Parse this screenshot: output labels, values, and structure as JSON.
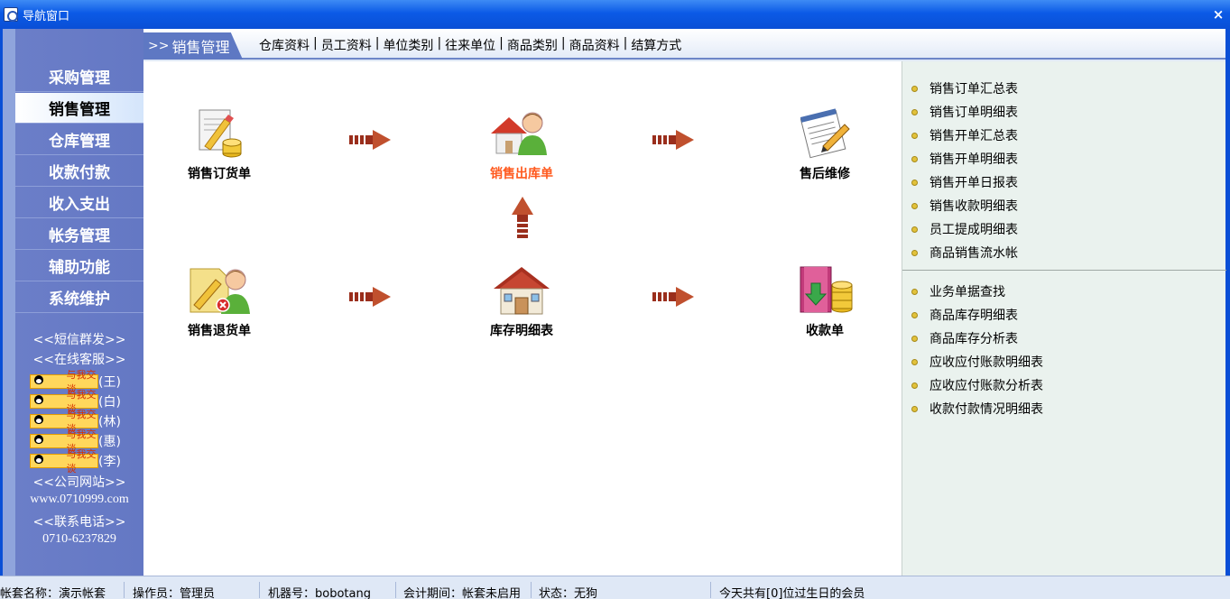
{
  "window": {
    "title": "导航窗口",
    "close_label": "×"
  },
  "sidebar": {
    "items": [
      {
        "label": "采购管理"
      },
      {
        "label": "销售管理"
      },
      {
        "label": "仓库管理"
      },
      {
        "label": "收款付款"
      },
      {
        "label": "收入支出"
      },
      {
        "label": "帐务管理"
      },
      {
        "label": "辅助功能"
      },
      {
        "label": "系统维护"
      }
    ],
    "active_index": 1,
    "sms": "<<短信群发>>",
    "online_service": "<<在线客服>>",
    "qq_badge": "与我交谈",
    "agents": [
      {
        "name": "(王)"
      },
      {
        "name": "(白)"
      },
      {
        "name": "(林)"
      },
      {
        "name": "(惠)"
      },
      {
        "name": "(李)"
      }
    ],
    "website_label": "<<公司网站>>",
    "website_url": "www.0710999.com",
    "phone_label": "<<联系电话>>",
    "phone": "0710-6237829"
  },
  "header": {
    "active_prefix": ">>",
    "active_tab": "销售管理",
    "links": [
      "仓库资料",
      "员工资料",
      "单位类别",
      "往来单位",
      "商品类别",
      "商品资料",
      "结算方式"
    ],
    "separator": "|"
  },
  "flow": {
    "sales_order": "销售订货单",
    "sales_outbound": "销售出库单",
    "after_sales": "售后维修",
    "sales_return": "销售退货单",
    "inventory_detail": "库存明细表",
    "receipt": "收款单"
  },
  "reports": {
    "group1": [
      "销售订单汇总表",
      "销售订单明细表",
      "销售开单汇总表",
      "销售开单明细表",
      "销售开单日报表",
      "销售收款明细表",
      "员工提成明细表",
      "商品销售流水帐"
    ],
    "group2": [
      "业务单据查找",
      "商品库存明细表",
      "商品库存分析表",
      "应收应付账款明细表",
      "应收应付账款分析表",
      "收款付款情况明细表"
    ]
  },
  "status": {
    "account": "帐套名称：演示帐套",
    "operator": "操作员：管理员",
    "machine": "机器号：bobotang",
    "period": "会计期间：帐套未启用",
    "state": "状态：无狗",
    "birthday": "今天共有[0]位过生日的会员"
  },
  "colors": {
    "accent": "#5e78c3",
    "highlight": "#ff5a1f",
    "titlebar": "#0b5ae6"
  }
}
